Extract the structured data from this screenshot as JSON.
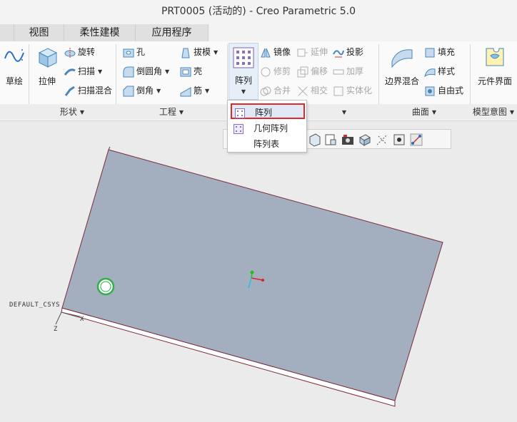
{
  "window": {
    "title": "PRT0005 (活动的) - Creo Parametric 5.0"
  },
  "tabs": [
    "视图",
    "柔性建模",
    "应用程序"
  ],
  "ribbon": {
    "sketch": {
      "label": "草绘"
    },
    "shape": {
      "footer": "形状",
      "extrude": "拉伸",
      "revolve": "旋转",
      "sweep": "扫描",
      "swept_blend": "扫描混合"
    },
    "engineering": {
      "footer": "工程",
      "hole": "孔",
      "round": "倒圆角",
      "chamfer": "倒角",
      "draft": "拔模",
      "shell": "壳",
      "rib": "筋"
    },
    "editing": {
      "pattern": "阵列",
      "mirror": "镜像",
      "trim": "修剪",
      "merge": "合并",
      "extend": "延伸",
      "offset": "偏移",
      "intersect": "相交",
      "project": "投影",
      "thicken": "加厚",
      "solidify": "实体化"
    },
    "surfaces": {
      "footer": "曲面",
      "boundary_blend": "边界混合",
      "fill": "填充",
      "style": "样式",
      "freestyle": "自由式"
    },
    "model_intent": {
      "footer": "模型意图",
      "component_interface": "元件界面"
    }
  },
  "dropdown": {
    "items": [
      "阵列",
      "几何阵列",
      "阵列表"
    ]
  },
  "viewport": {
    "csys_label": "DEFAULT_CSYS",
    "axis_z": "Z",
    "axis_x": "X"
  },
  "colors": {
    "plate": "#a3afbf",
    "plate_edge": "#7a2b3b",
    "highlight": "#e0292b",
    "hole": "#2bb04a"
  }
}
